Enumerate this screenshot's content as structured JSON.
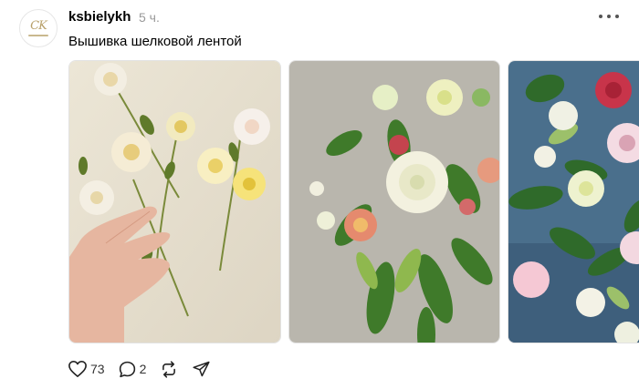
{
  "post": {
    "username": "ksbielykh",
    "time": "5 ч.",
    "caption": "Вышивка шелковой лентой"
  },
  "avatar": {
    "mark": "CK"
  },
  "icons": {
    "more": "more-horizontal-icon",
    "like": "heart-icon",
    "reply": "comment-bubble-icon",
    "repost": "repost-icon",
    "share": "send-icon"
  },
  "actions": {
    "likes": "73",
    "replies": "2"
  }
}
